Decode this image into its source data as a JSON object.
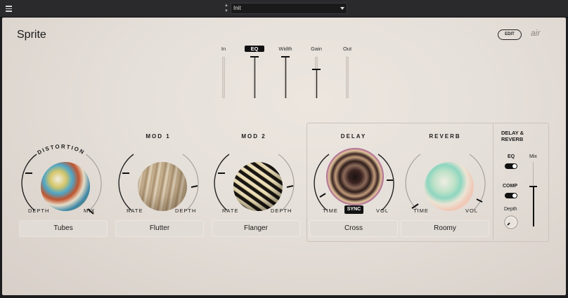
{
  "topbar": {
    "preset_name": "Init"
  },
  "plugin": {
    "title": "Sprite",
    "edit_label": "EDIT",
    "brand": "air"
  },
  "faders": [
    {
      "label": "In",
      "value": 0.0
    },
    {
      "label": "EQ",
      "value": 1.0
    },
    {
      "label": "Width",
      "value": 1.0
    },
    {
      "label": "Gain",
      "value": 0.7
    },
    {
      "label": "Out",
      "value": 0.0
    }
  ],
  "modules": [
    {
      "title": "DISTORTION",
      "left_label": "DEPTH",
      "right_label": "MIX",
      "preset": "Tubes"
    },
    {
      "title": "MOD 1",
      "left_label": "RATE",
      "right_label": "DEPTH",
      "preset": "Flutter"
    },
    {
      "title": "MOD 2",
      "left_label": "RATE",
      "right_label": "DEPTH",
      "preset": "Flanger"
    },
    {
      "title": "DELAY",
      "left_label": "TIME",
      "right_label": "VOL",
      "sync_label": "SYNC",
      "preset": "Cross"
    },
    {
      "title": "REVERB",
      "left_label": "TIME",
      "right_label": "VOL",
      "preset": "Roomy"
    }
  ],
  "delay_reverb": {
    "title_line1": "DELAY &",
    "title_line2": "REVERB",
    "eq_label": "EQ",
    "comp_label": "COMP",
    "depth_label": "Depth",
    "mix_label": "Mix",
    "eq_on": true,
    "comp_on": true,
    "mix_value": 0.62
  }
}
